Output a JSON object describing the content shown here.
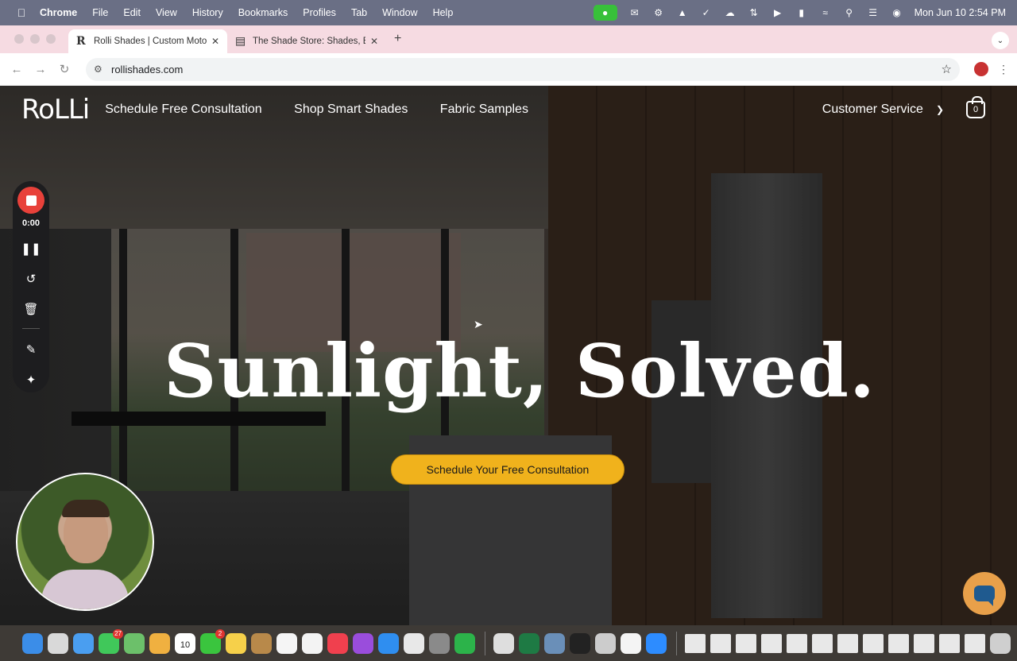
{
  "menubar": {
    "app_name": "Chrome",
    "items": [
      "File",
      "Edit",
      "View",
      "History",
      "Bookmarks",
      "Profiles",
      "Tab",
      "Window",
      "Help"
    ],
    "clock": "Mon Jun 10  2:54 PM"
  },
  "browser": {
    "tabs": [
      {
        "favicon": "R",
        "title": "Rolli Shades | Custom Motoriz"
      },
      {
        "favicon": "doc-icon",
        "title": "The Shade Store: Shades, Blin"
      }
    ],
    "url": "rollishades.com"
  },
  "site": {
    "logo": "RoLLi",
    "nav": [
      "Schedule Free Consultation",
      "Shop Smart Shades",
      "Fabric Samples"
    ],
    "customer_service": "Customer Service",
    "cart_count": "0",
    "headline": "Sunlight, Solved.",
    "cta_label": "Schedule Your Free Consultation"
  },
  "recorder": {
    "time": "0:00"
  },
  "dock": {
    "calendar_month": "JUN",
    "calendar_day": "10",
    "messages_badge": "27",
    "facetime_badge": "2",
    "apps": [
      {
        "name": "finder-icon",
        "color": "#3b8de8"
      },
      {
        "name": "launchpad-icon",
        "color": "#d9d9d9"
      },
      {
        "name": "mail-icon",
        "color": "#4a9ef0"
      },
      {
        "name": "messages-icon",
        "color": "#40c85a"
      },
      {
        "name": "maps-icon",
        "color": "#6cc06a"
      },
      {
        "name": "photos-icon",
        "color": "#f0b040"
      },
      {
        "name": "calendar-icon",
        "color": "#ffffff"
      },
      {
        "name": "facetime-icon",
        "color": "#3ac53e"
      },
      {
        "name": "notes-icon",
        "color": "#f6d04a"
      },
      {
        "name": "contacts-icon",
        "color": "#b8894a"
      },
      {
        "name": "reminders-icon",
        "color": "#f5f5f5"
      },
      {
        "name": "freeform-icon",
        "color": "#f3f3f3"
      },
      {
        "name": "music-icon",
        "color": "#f0404e"
      },
      {
        "name": "podcasts-icon",
        "color": "#9a4ddc"
      },
      {
        "name": "appstore-icon",
        "color": "#2f8ef0"
      },
      {
        "name": "chrome-icon",
        "color": "#e8e8e8"
      },
      {
        "name": "settings-icon",
        "color": "#8a8a8a"
      },
      {
        "name": "evernote-icon",
        "color": "#2cb34a"
      }
    ],
    "apps2": [
      {
        "name": "vectornator-icon",
        "color": "#dedede"
      },
      {
        "name": "excel-icon",
        "color": "#1e7a44"
      },
      {
        "name": "preview-icon",
        "color": "#6a8fb8"
      },
      {
        "name": "terminal-icon",
        "color": "#222222"
      },
      {
        "name": "printer-icon",
        "color": "#cccccc"
      },
      {
        "name": "chatgpt-icon",
        "color": "#f4f4f4"
      },
      {
        "name": "zoom-icon",
        "color": "#2d8cff"
      }
    ]
  }
}
